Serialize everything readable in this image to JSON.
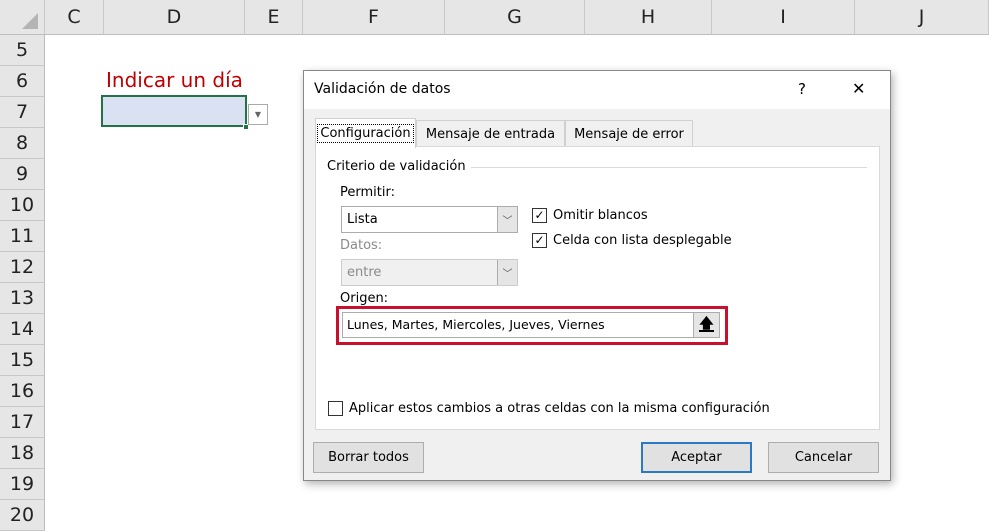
{
  "sheet": {
    "columns": [
      "C",
      "D",
      "E",
      "F",
      "G",
      "H",
      "I",
      "J"
    ],
    "rows": [
      "5",
      "6",
      "7",
      "8",
      "9",
      "10",
      "11",
      "12",
      "13",
      "14",
      "15",
      "16",
      "17",
      "18",
      "19",
      "20"
    ],
    "label_cell": "Indicar un día",
    "label_color": "#c00000"
  },
  "dialog": {
    "title": "Validación de datos",
    "help": "?",
    "close": "✕",
    "tabs": [
      "Configuración",
      "Mensaje de entrada",
      "Mensaje de error"
    ],
    "group_title": "Criterio de validación",
    "permitir_label": "Permitir:",
    "permitir_value": "Lista",
    "datos_label": "Datos:",
    "datos_value": "entre",
    "omitir_label": "Omitir blancos",
    "omitir_checked": true,
    "celda_label": "Celda con lista desplegable",
    "celda_checked": true,
    "origen_label": "Origen:",
    "origen_value": "Lunes, Martes, Miercoles, Jueves, Viernes",
    "aplicar_label": "Aplicar estos cambios a otras celdas con la misma configuración",
    "aplicar_checked": false,
    "buttons": {
      "clear": "Borrar todos",
      "ok": "Aceptar",
      "cancel": "Cancelar"
    },
    "highlight_color": "#c8102e"
  }
}
